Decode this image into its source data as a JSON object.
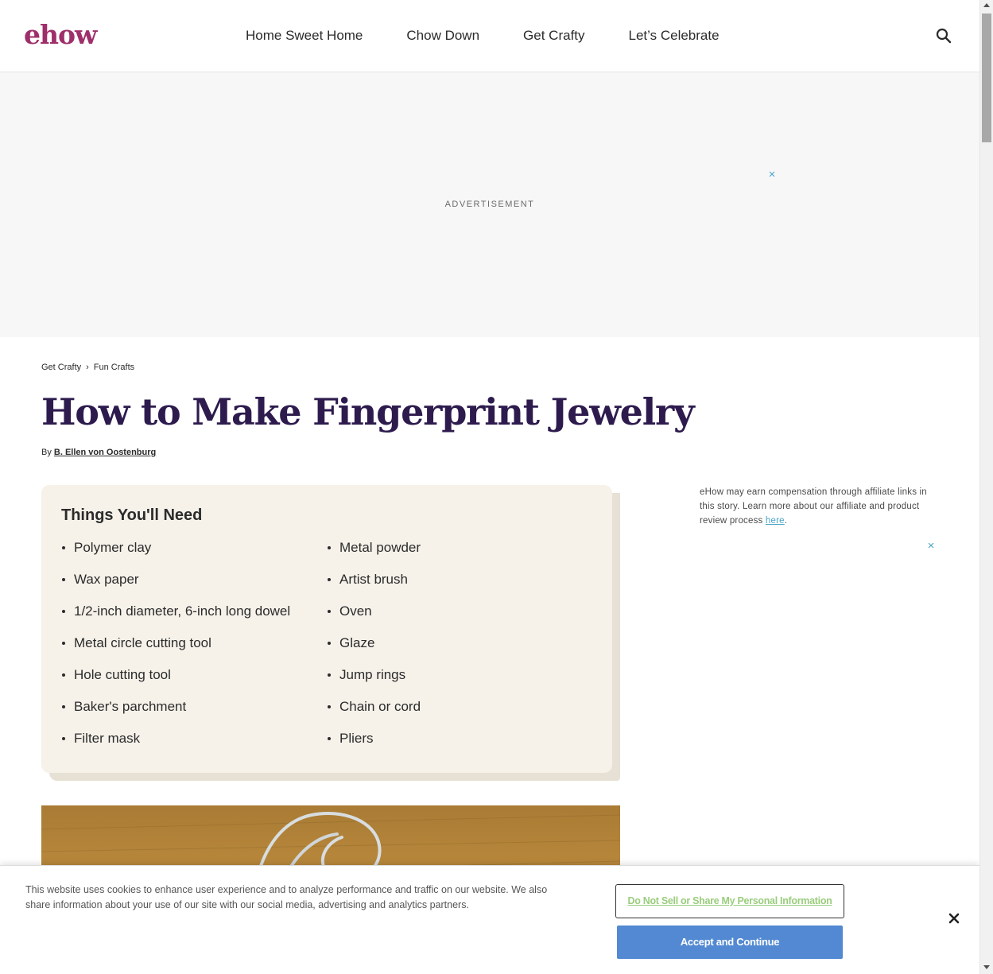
{
  "header": {
    "logo": "ehow",
    "nav": [
      "Home Sweet Home",
      "Chow Down",
      "Get Crafty",
      "Let’s Celebrate"
    ],
    "search_icon": "search-icon"
  },
  "ad": {
    "label": "ADVERTISEMENT",
    "close": "×"
  },
  "breadcrumb": {
    "items": [
      "Get Crafty",
      "Fun Crafts"
    ],
    "separator": "›"
  },
  "article": {
    "title": "How to Make Fingerprint Jewelry",
    "by_label": "By",
    "author": "B. Ellen von Oostenburg"
  },
  "things": {
    "heading": "Things You'll Need",
    "left": [
      "Polymer clay",
      "Wax paper",
      "1/2-inch diameter, 6-inch long dowel",
      "Metal circle cutting tool",
      "Hole cutting tool",
      "Baker's parchment",
      "Filter mask"
    ],
    "right": [
      "Metal powder",
      "Artist brush",
      "Oven",
      "Glaze",
      "Jump rings",
      "Chain or cord",
      "Pliers"
    ]
  },
  "sidebar": {
    "affiliate_text": "eHow may earn compensation through affiliate links in this story. Learn more about our affiliate and product review process ",
    "affiliate_link": "here",
    "affiliate_end": ".",
    "close": "×"
  },
  "cookie": {
    "text": "This website uses cookies to enhance user experience and to analyze performance and traffic on our website. We also share information about your use of our site with our social media, advertising and analytics partners.",
    "do_not_sell": "Do Not Sell or Share My Personal Information",
    "accept": "Accept and Continue",
    "close_icon": "close-icon"
  },
  "colors": {
    "brand": "#9e2f6a",
    "title": "#2d1b4e",
    "accent_link": "#4aa3c8",
    "accept_button": "#5289d2",
    "box_bg": "#f6f2ea"
  }
}
